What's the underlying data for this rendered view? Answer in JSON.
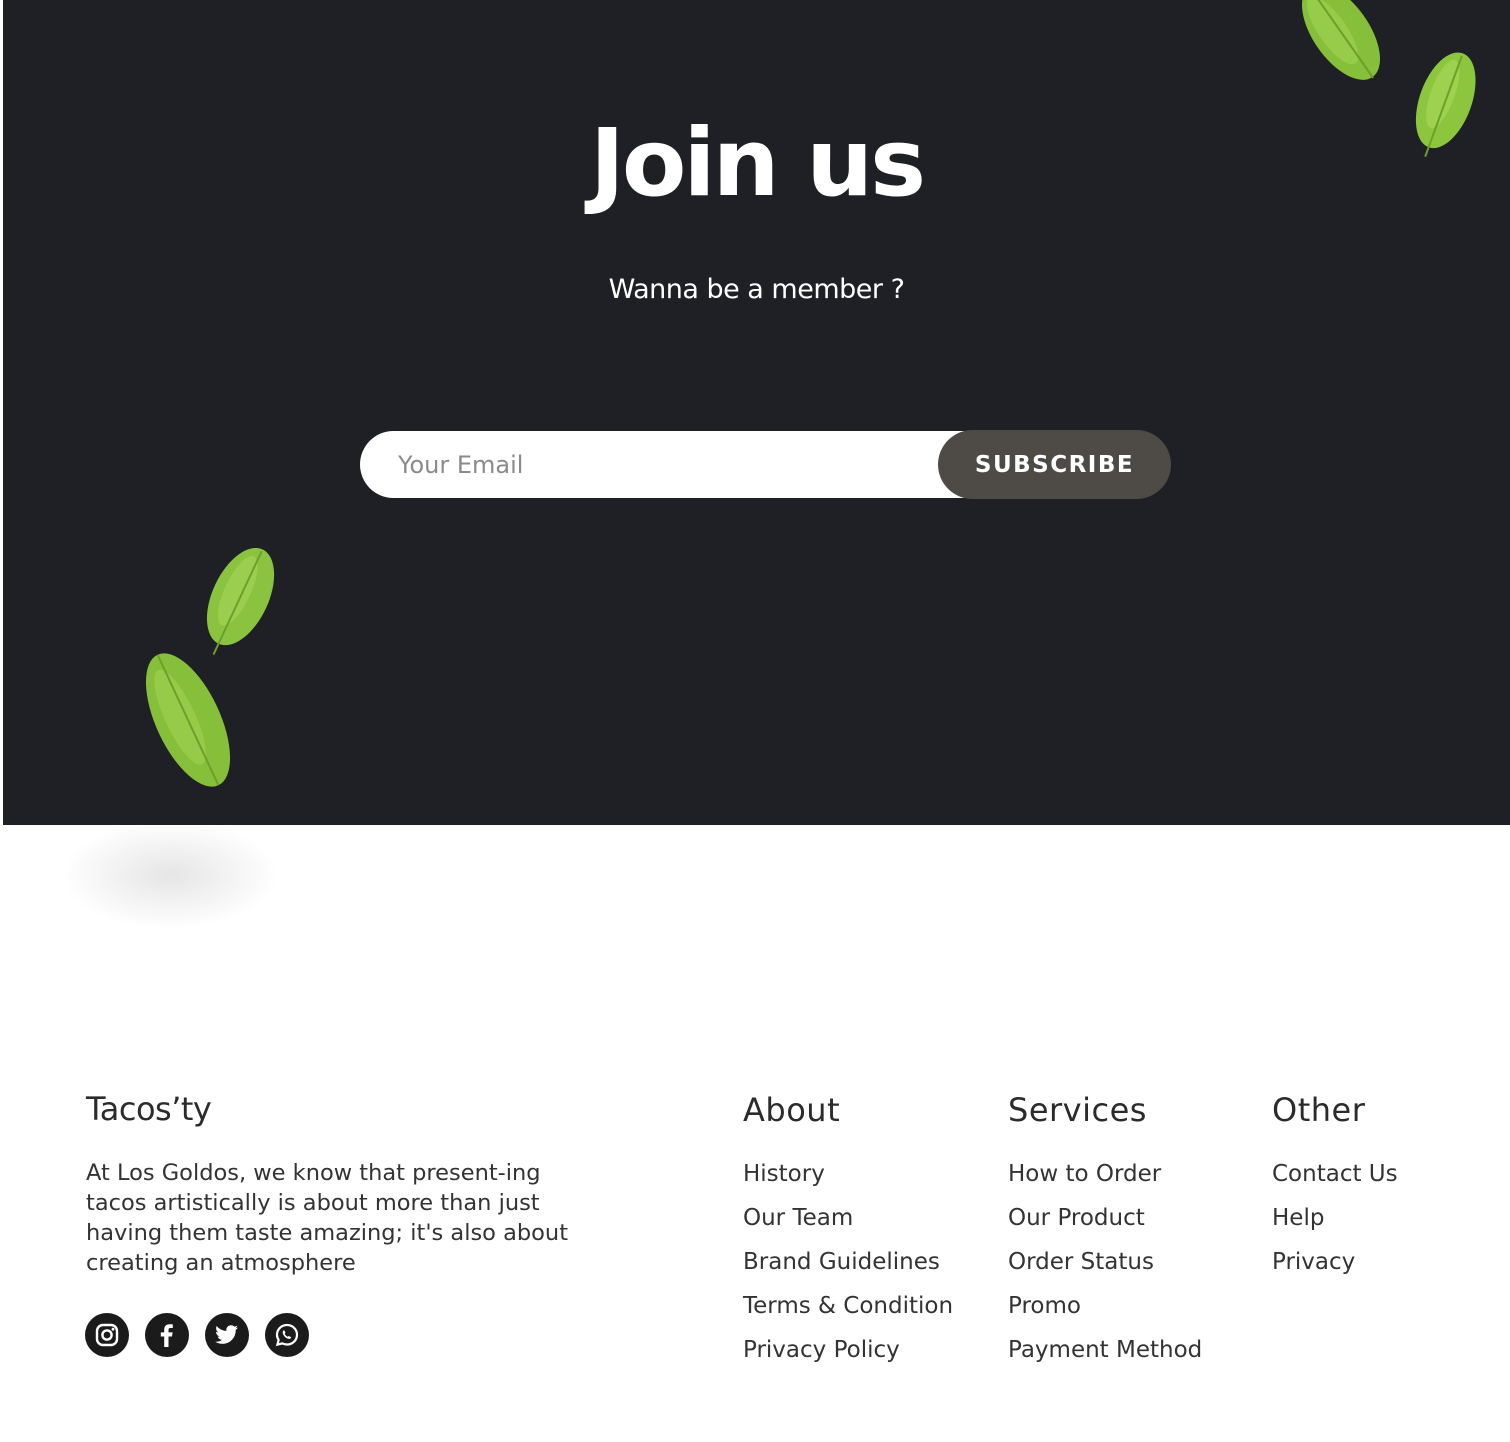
{
  "hero": {
    "title": "Join us",
    "subtitle": "Wanna be  a member ?",
    "email_placeholder": "Your Email",
    "subscribe_label": "SUBSCRIBE"
  },
  "footer": {
    "brand": "Tacos’ty",
    "description": "At Los Goldos, we know that present-ing tacos artistically is about more than just having them taste amazing; it's also about creating an atmosphere",
    "social": [
      "instagram-icon",
      "facebook-icon",
      "twitter-icon",
      "whatsapp-icon"
    ],
    "columns": [
      {
        "title": "About",
        "links": [
          "History",
          "Our Team",
          "Brand Guidelines",
          "Terms & Condition",
          "Privacy Policy"
        ]
      },
      {
        "title": "Services",
        "links": [
          "How to Order",
          "Our Product",
          "Order Status",
          "Promo",
          "Payment Method"
        ]
      },
      {
        "title": "Other",
        "links": [
          "Contact Us",
          "Help",
          "Privacy"
        ]
      }
    ]
  },
  "colors": {
    "hero_background": "#1f2025",
    "button_background": "#4e4b47",
    "leaf_green": "#8cc63f"
  }
}
